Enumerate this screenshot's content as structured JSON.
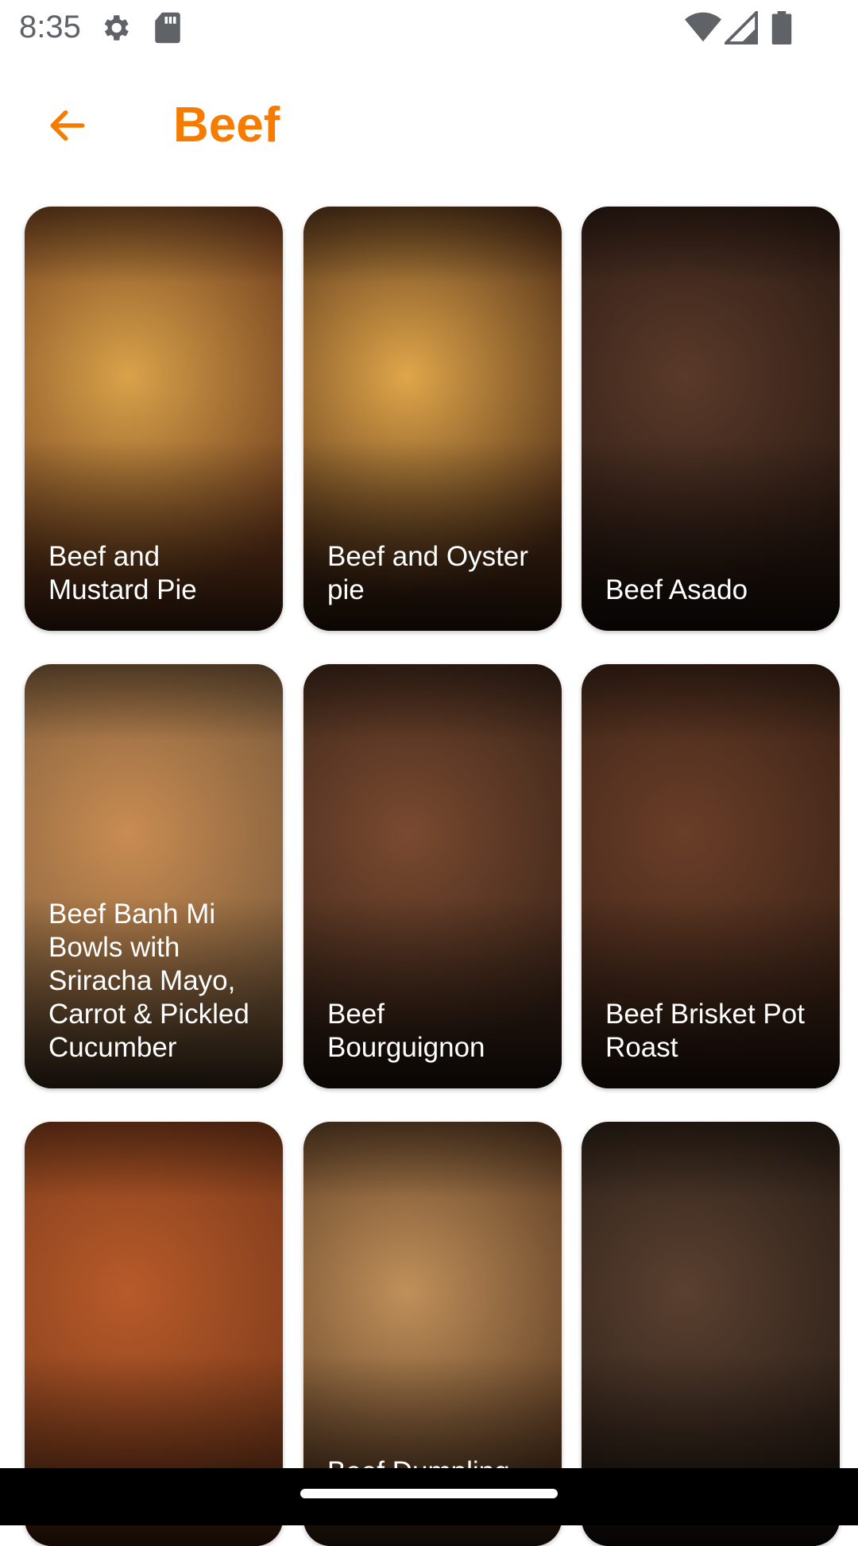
{
  "status_bar": {
    "time": "8:35",
    "icons": [
      "settings-icon",
      "sd-card-icon",
      "wifi-icon",
      "cell-signal-icon",
      "battery-icon"
    ]
  },
  "app_bar": {
    "back_icon": "arrow-back-icon",
    "title": "Beef",
    "accent_color": "#f57c00"
  },
  "meals": [
    {
      "name": "Beef and Mustard Pie",
      "colors": [
        "#d9a24a",
        "#6b3a1c"
      ]
    },
    {
      "name": "Beef and Oyster pie",
      "colors": [
        "#e0a64a",
        "#4a2a16"
      ]
    },
    {
      "name": "Beef Asado",
      "colors": [
        "#5a3a2a",
        "#2b1a12"
      ]
    },
    {
      "name": "Beef Banh Mi Bowls with Sriracha Mayo, Carrot & Pickled Cucumber",
      "colors": [
        "#c98c52",
        "#7a5a3a"
      ]
    },
    {
      "name": "Beef Bourguignon",
      "colors": [
        "#7a4a30",
        "#3a2418"
      ]
    },
    {
      "name": "Beef Brisket Pot Roast",
      "colors": [
        "#6a3e28",
        "#3a2216"
      ]
    },
    {
      "name": "",
      "colors": [
        "#b85a2a",
        "#7a3a1a"
      ]
    },
    {
      "name": "Beef Dumpling Stew",
      "colors": [
        "#c0905a",
        "#5a3a22"
      ]
    },
    {
      "name": "",
      "colors": [
        "#5a4030",
        "#2a1e16"
      ]
    }
  ],
  "nav_bar": {
    "handle": "home-handle"
  }
}
